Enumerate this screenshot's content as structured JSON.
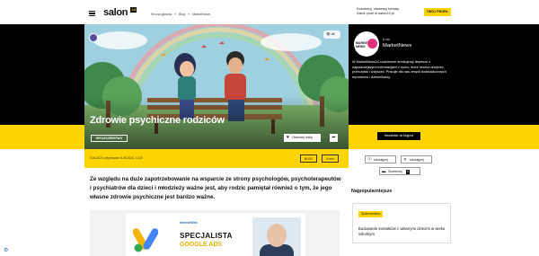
{
  "header": {
    "logo": "salon",
    "logo_badge": "24",
    "breadcrumbs": [
      "Strona główna",
      "»",
      "Blog",
      "»",
      "MarketNews"
    ],
    "promo_line1": "Komentuj, obserwuj tematy.",
    "promo_line2": "Załóż profil w salon24.pl",
    "promo_button": "TWÓJ PROFIL"
  },
  "hero": {
    "title": "Zdrowie psychiczne rodziców",
    "category": "SPOŁECZEŃSTWO",
    "views": "48",
    "follow_label": "Obserwuj notkę",
    "share_icon": "share-icon",
    "heart_icon": "heart-icon"
  },
  "author": {
    "logo_text": "MARKET NEWS",
    "small": "8 min",
    "name": "MarketNews",
    "description": "W MarketNews24 codziennie armitujemy depesze z najważniejszymi informacjami z rynku, które można obejrzeć, przeczytać i usłyszeć. Pracuje dla nas zespół doświadczonych reporterów i dziennikarzy.",
    "all_posts": "Newsletter od blogera"
  },
  "meta": {
    "date": "6.06.2024, edytowane: 6.06.2024, 12:20",
    "blog_chip": "BLOG",
    "min_chip": "8 min"
  },
  "share": {
    "facebook": "Udostępnij",
    "x": "Udostępnij",
    "comments": "Skomentuj",
    "comments_count": "0"
  },
  "article": {
    "lead": "Ze względu na duże zapotrzebowanie na wsparcie ze strony psychologów, psychoterapeutów i psychiatrów dla dzieci i młodzieży ważne jest, aby rodzic pamiętał również o tym, że jego własne zdrowie psychiczne jest bardzo ważne."
  },
  "ad": {
    "brand": "InternetWeb",
    "line1": "SPECJALISTA",
    "line2": "GOOGLE ADS"
  },
  "sidebar": {
    "popular_heading": "Najpopularniejsze",
    "card_chip": "Społeczeństwo",
    "card_title": "Budowanie kontaktów z własnymi dziećmi w wieku szkolnym"
  },
  "colors": {
    "accent": "#ffd400",
    "dark": "#000000"
  }
}
